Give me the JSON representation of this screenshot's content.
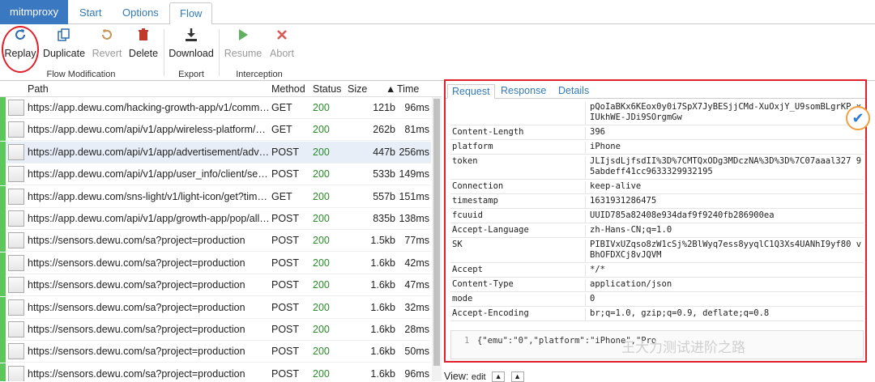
{
  "app": {
    "brand": "mitmproxy",
    "tabs": [
      "Start",
      "Options",
      "Flow"
    ],
    "active_tab": "Flow"
  },
  "toolbar": {
    "flow_modification": {
      "label": "Flow Modification",
      "buttons": [
        {
          "label": "Replay",
          "icon": "replay-icon"
        },
        {
          "label": "Duplicate",
          "icon": "duplicate-icon"
        },
        {
          "label": "Revert",
          "icon": "revert-icon"
        },
        {
          "label": "Delete",
          "icon": "trash-icon"
        }
      ]
    },
    "export": {
      "label": "Export",
      "buttons": [
        {
          "label": "Download",
          "icon": "download-icon"
        }
      ]
    },
    "interception": {
      "label": "Interception",
      "buttons": [
        {
          "label": "Resume",
          "icon": "play-icon"
        },
        {
          "label": "Abort",
          "icon": "close-icon"
        }
      ]
    }
  },
  "flows": {
    "columns": [
      "Path",
      "Method",
      "Status",
      "Size",
      "Time"
    ],
    "rows": [
      {
        "path": "https://app.dewu.com/hacking-growth-app/v1/common...",
        "method": "GET",
        "status": "200",
        "size": "121b",
        "time": "96ms"
      },
      {
        "path": "https://app.dewu.com/api/v1/app/wireless-platform/offli...",
        "method": "GET",
        "status": "200",
        "size": "262b",
        "time": "81ms"
      },
      {
        "path": "https://app.dewu.com/api/v1/app/advertisement/adv/g...",
        "method": "POST",
        "status": "200",
        "size": "447b",
        "time": "256ms"
      },
      {
        "path": "https://app.dewu.com/api/v1/app/user_info/client/setP...",
        "method": "POST",
        "status": "200",
        "size": "533b",
        "time": "149ms"
      },
      {
        "path": "https://app.dewu.com/sns-light/v1/light-icon/get?timest...",
        "method": "GET",
        "status": "200",
        "size": "557b",
        "time": "151ms"
      },
      {
        "path": "https://app.dewu.com/api/v1/app/growth-app/pop/allC...",
        "method": "POST",
        "status": "200",
        "size": "835b",
        "time": "138ms"
      },
      {
        "path": "https://sensors.dewu.com/sa?project=production",
        "method": "POST",
        "status": "200",
        "size": "1.5kb",
        "time": "77ms"
      },
      {
        "path": "https://sensors.dewu.com/sa?project=production",
        "method": "POST",
        "status": "200",
        "size": "1.6kb",
        "time": "42ms"
      },
      {
        "path": "https://sensors.dewu.com/sa?project=production",
        "method": "POST",
        "status": "200",
        "size": "1.6kb",
        "time": "47ms"
      },
      {
        "path": "https://sensors.dewu.com/sa?project=production",
        "method": "POST",
        "status": "200",
        "size": "1.6kb",
        "time": "32ms"
      },
      {
        "path": "https://sensors.dewu.com/sa?project=production",
        "method": "POST",
        "status": "200",
        "size": "1.6kb",
        "time": "28ms"
      },
      {
        "path": "https://sensors.dewu.com/sa?project=production",
        "method": "POST",
        "status": "200",
        "size": "1.6kb",
        "time": "50ms"
      },
      {
        "path": "https://sensors.dewu.com/sa?project=production",
        "method": "POST",
        "status": "200",
        "size": "1.6kb",
        "time": "96ms"
      }
    ]
  },
  "detail": {
    "tabs": [
      "Request",
      "Response",
      "Details"
    ],
    "active_tab": "Request",
    "headers": [
      {
        "key": "",
        "value": "pQoIaBKx6KEox0y0i7SpX7JyBESjjCMd-XuOxjY_U9somBLgrKP xIUkhWE-JDi9SOrgmGw"
      },
      {
        "key": "Content-Length",
        "value": "396"
      },
      {
        "key": "platform",
        "value": "iPhone"
      },
      {
        "key": "token",
        "value": "JLIjsdLjfsdII%3D%7CMTQxODg3MDczNA%3D%3D%7C07aaal327 95abdeff41cc9633329932195"
      },
      {
        "key": "Connection",
        "value": "keep-alive"
      },
      {
        "key": "timestamp",
        "value": "1631931286475"
      },
      {
        "key": "fcuuid",
        "value": "UUID785a82408e934daf9f9240fb286900ea"
      },
      {
        "key": "Accept-Language",
        "value": "zh-Hans-CN;q=1.0"
      },
      {
        "key": "SK",
        "value": "PIBIVxUZqso8zW1cSj%2BlWyq7ess8yyqlC1Q3Xs4UANhI9yf80 vBhOFDXCj8vJQVM"
      },
      {
        "key": "Accept",
        "value": "*/*"
      },
      {
        "key": "Content-Type",
        "value": "application/json"
      },
      {
        "key": "mode",
        "value": "0"
      },
      {
        "key": "Accept-Encoding",
        "value": "br;q=1.0, gzip;q=0.9, deflate;q=0.8"
      }
    ],
    "body": {
      "line_no": "1",
      "text": "{\"emu\":\"0\",\"platform\":\"iPhone\",\"Pro"
    },
    "watermark": "王大力测试进阶之路"
  },
  "viewbar": {
    "label": "View:",
    "mode": "edit"
  }
}
